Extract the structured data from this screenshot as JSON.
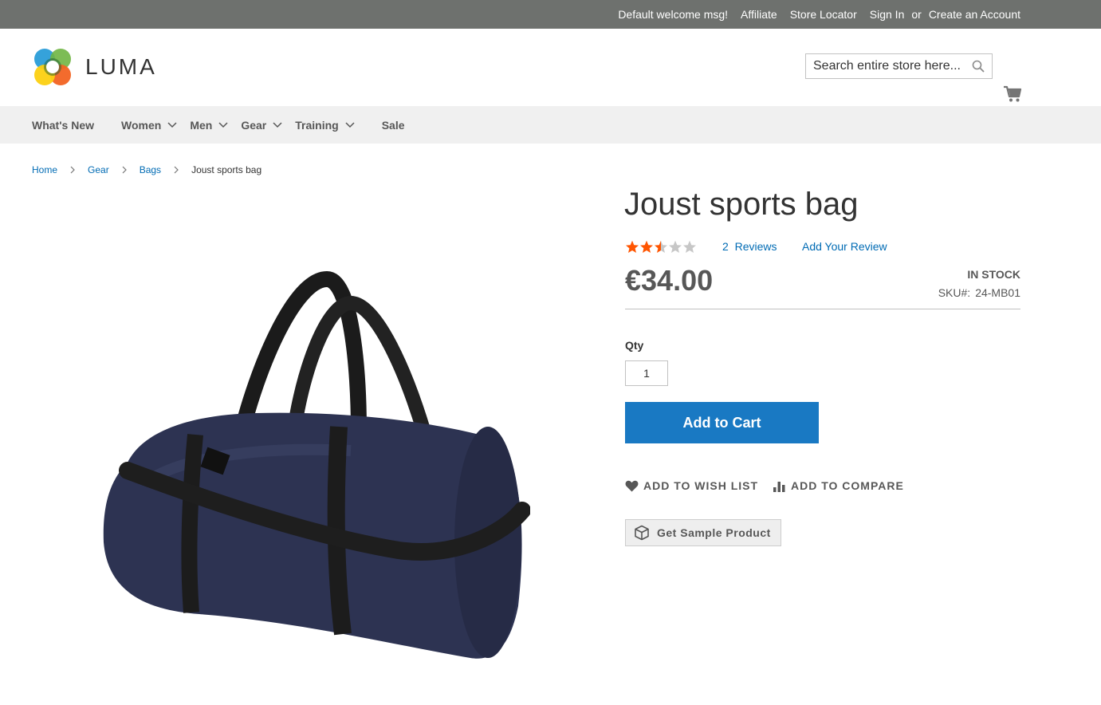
{
  "top_panel": {
    "welcome": "Default welcome msg!",
    "affiliate": "Affiliate",
    "store_locator": "Store Locator",
    "sign_in": "Sign In",
    "or": "or",
    "create_account": "Create an Account"
  },
  "header": {
    "logo_text": "LUMA",
    "search_placeholder": "Search entire store here...",
    "search_icon": "search-icon",
    "cart_icon": "cart-icon"
  },
  "nav": {
    "items": [
      {
        "label": "What's New",
        "has_submenu": false
      },
      {
        "label": "Women",
        "has_submenu": true
      },
      {
        "label": "Men",
        "has_submenu": true
      },
      {
        "label": "Gear",
        "has_submenu": true
      },
      {
        "label": "Training",
        "has_submenu": true
      },
      {
        "label": "Sale",
        "has_submenu": false
      }
    ]
  },
  "breadcrumb": {
    "items": [
      "Home",
      "Gear",
      "Bags"
    ],
    "current": "Joust sports bag"
  },
  "product": {
    "title": "Joust sports bag",
    "rating_stars": 2.5,
    "rating_max": 5,
    "reviews_count": "2",
    "reviews_label": "Reviews",
    "add_review_label": "Add Your Review",
    "price": "€34.00",
    "stock": "In stock",
    "sku_label": "SKU#:",
    "sku_value": "24-MB01",
    "qty_label": "Qty",
    "qty_value": "1",
    "add_to_cart": "Add to Cart",
    "wishlist_label": "Add to Wish List",
    "compare_label": "Add to Compare",
    "sample_label": "Get Sample Product"
  },
  "colors": {
    "top_panel_bg": "#6e716e",
    "link": "#006bb4",
    "primary_button": "#1979c3",
    "star_filled": "#ff5501",
    "star_empty": "#c7c7c7",
    "bag": "#2d3352"
  }
}
